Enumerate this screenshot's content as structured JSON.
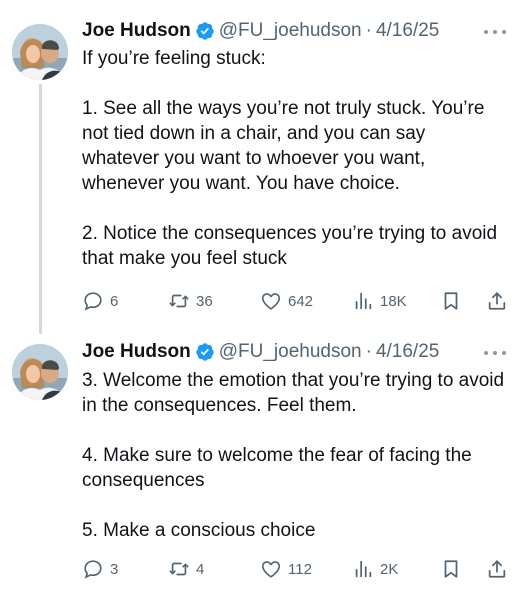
{
  "tweets": [
    {
      "author": {
        "name": "Joe Hudson",
        "handle": "@FU_joehudson",
        "verified": true
      },
      "date": "4/16/25",
      "separator": "·",
      "paragraphs": [
        "If you’re feeling stuck:",
        "1. See all the ways you’re not truly stuck. You’re not tied down in a chair, and you can say whatever you want to whoever you want, whenever you want. You have choice.",
        "2. Notice the consequences you’re trying to avoid that make you feel stuck"
      ],
      "stats": {
        "replies": "6",
        "retweets": "36",
        "likes": "642",
        "views": "18K"
      }
    },
    {
      "author": {
        "name": "Joe Hudson",
        "handle": "@FU_joehudson",
        "verified": true
      },
      "date": "4/16/25",
      "separator": "·",
      "paragraphs": [
        "3. Welcome the emotion that you’re trying to avoid in the consequences. Feel them.",
        "4. Make sure to welcome the fear of facing the consequences",
        "5. Make a conscious choice"
      ],
      "stats": {
        "replies": "3",
        "retweets": "4",
        "likes": "112",
        "views": "2K"
      }
    }
  ],
  "icons": {
    "verified": "verified-badge-icon",
    "more": "more-icon",
    "reply": "reply-icon",
    "retweet": "retweet-icon",
    "like": "like-icon",
    "views": "views-icon",
    "bookmark": "bookmark-icon",
    "share": "share-icon"
  },
  "colors": {
    "accent": "#1d9bf0",
    "text": "#0f1419",
    "secondary": "#536471",
    "thread_line": "#cfd9de"
  }
}
